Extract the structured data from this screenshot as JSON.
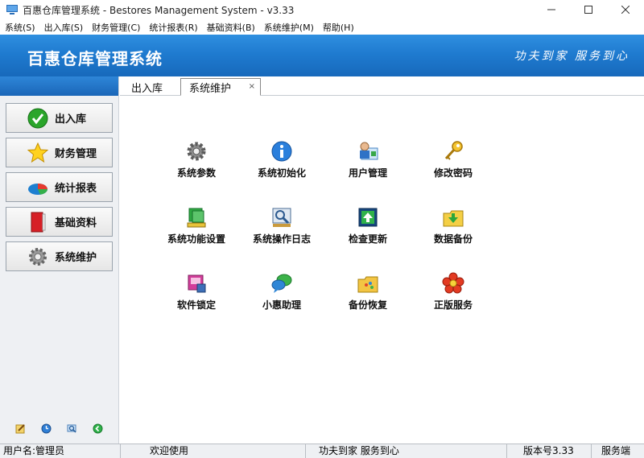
{
  "window": {
    "title": "百惠仓库管理系统 - Bestores Management System - v3.33"
  },
  "menu": [
    "系统(S)",
    "出入库(S)",
    "财务管理(C)",
    "统计报表(R)",
    "基础资料(B)",
    "系统维护(M)",
    "帮助(H)"
  ],
  "banner": {
    "brand": "百惠仓库管理系统",
    "slogan": "功夫到家 服务到心"
  },
  "sidebar": {
    "items": [
      {
        "label": "出入库",
        "icon": "check-icon"
      },
      {
        "label": "财务管理",
        "icon": "star-icon"
      },
      {
        "label": "统计报表",
        "icon": "pie-chart-icon"
      },
      {
        "label": "基础资料",
        "icon": "book-icon"
      },
      {
        "label": "系统维护",
        "icon": "gear-icon"
      }
    ],
    "footer_icons": [
      "edit-icon",
      "clock-icon",
      "search-icon",
      "back-icon"
    ]
  },
  "tabs": [
    {
      "label": "出入库"
    },
    {
      "label": "系统维护",
      "close": "×"
    }
  ],
  "tiles": [
    {
      "label": "系统参数",
      "icon": "gear-icon"
    },
    {
      "label": "系统初始化",
      "icon": "info-icon"
    },
    {
      "label": "用户管理",
      "icon": "users-icon"
    },
    {
      "label": "修改密码",
      "icon": "key-icon"
    },
    {
      "label": "系统功能设置",
      "icon": "function-setup-icon"
    },
    {
      "label": "系统操作日志",
      "icon": "log-icon"
    },
    {
      "label": "检查更新",
      "icon": "update-icon"
    },
    {
      "label": "数据备份",
      "icon": "backup-icon"
    },
    {
      "label": "软件锁定",
      "icon": "lock-icon"
    },
    {
      "label": "小惠助理",
      "icon": "assistant-icon"
    },
    {
      "label": "备份恢复",
      "icon": "restore-icon"
    },
    {
      "label": "正版服务",
      "icon": "flower-icon"
    }
  ],
  "status": {
    "user": "用户名:管理员",
    "welcome": "欢迎使用",
    "slogan": "功夫到家 服务到心",
    "version": "版本号3.33",
    "mode": "服务端"
  },
  "colors": {
    "banner": "#1f7bd0",
    "panel": "#eef0f3"
  }
}
